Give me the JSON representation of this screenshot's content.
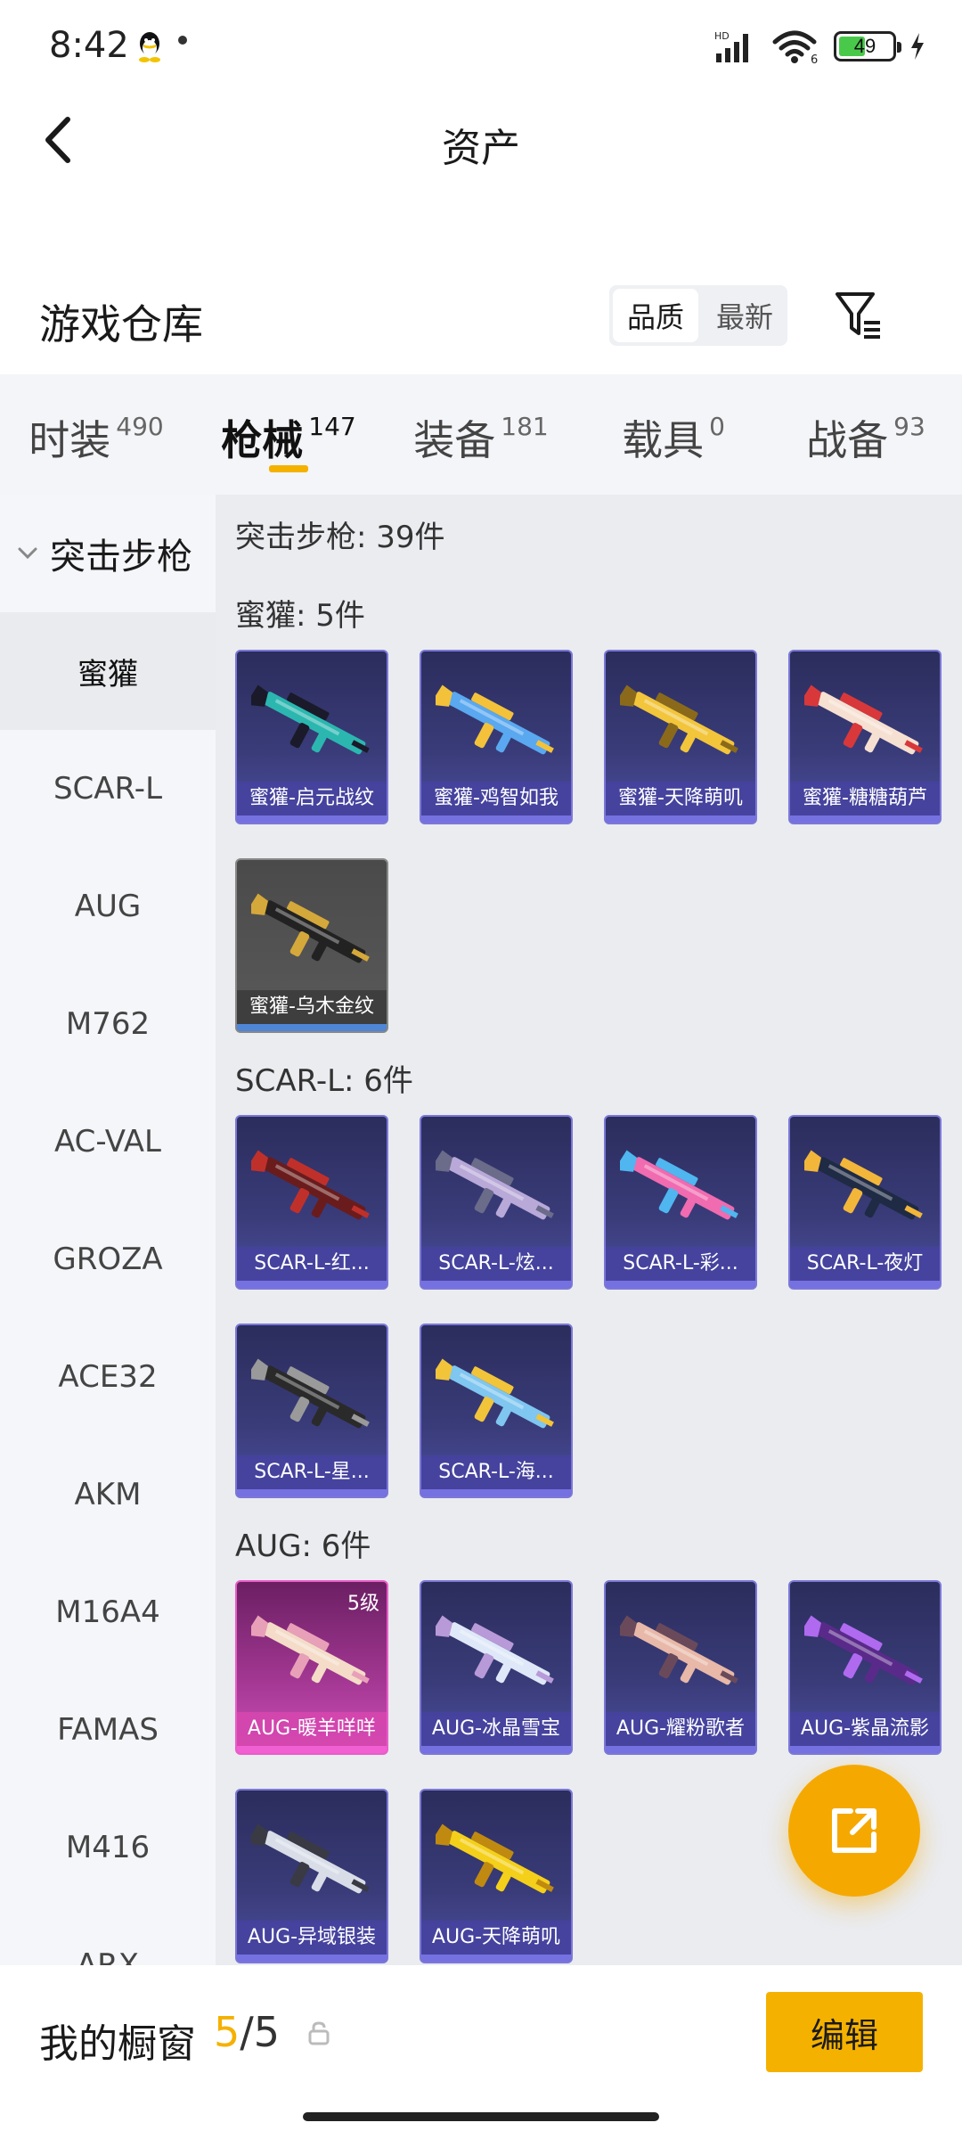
{
  "status_bar": {
    "time": "8:42",
    "battery": "49"
  },
  "header": {
    "title": "资产"
  },
  "warehouse": {
    "title": "游戏仓库",
    "sort_quality": "品质",
    "sort_newest": "最新"
  },
  "tabs": [
    {
      "label": "时装",
      "count": "490"
    },
    {
      "label": "枪械",
      "count": "147"
    },
    {
      "label": "装备",
      "count": "181"
    },
    {
      "label": "载具",
      "count": "0"
    },
    {
      "label": "战备",
      "count": "93"
    }
  ],
  "sidebar": {
    "category": "突击步枪",
    "items": [
      "蜜獾",
      "SCAR-L",
      "AUG",
      "M762",
      "AC-VAL",
      "GROZA",
      "ACE32",
      "AKM",
      "M16A4",
      "FAMAS",
      "M416",
      "ARX"
    ]
  },
  "content": {
    "category_summary": "突击步枪: 39件",
    "groups": [
      {
        "title": "蜜獾: 5件",
        "items": [
          {
            "label": "蜜獾-启元战纹"
          },
          {
            "label": "蜜獾-鸡智如我"
          },
          {
            "label": "蜜獾-天降萌叽"
          },
          {
            "label": "蜜獾-糖糖葫芦"
          },
          {
            "label": "蜜獾-乌木金纹"
          }
        ]
      },
      {
        "title": "SCAR-L: 6件",
        "items": [
          {
            "label": "SCAR-L-红..."
          },
          {
            "label": "SCAR-L-炫..."
          },
          {
            "label": "SCAR-L-彩..."
          },
          {
            "label": "SCAR-L-夜灯"
          },
          {
            "label": "SCAR-L-星..."
          },
          {
            "label": "SCAR-L-海..."
          }
        ]
      },
      {
        "title": "AUG: 6件",
        "items": [
          {
            "label": "AUG-暖羊咩咩",
            "level": "5级"
          },
          {
            "label": "AUG-冰晶雪宝"
          },
          {
            "label": "AUG-耀粉歌者"
          },
          {
            "label": "AUG-紫晶流影"
          },
          {
            "label": "AUG-异域银装"
          },
          {
            "label": "AUG-天降萌叽"
          }
        ]
      }
    ]
  },
  "bottom_bar": {
    "label": "我的橱窗",
    "current": "5",
    "separator": "/",
    "total": "5",
    "edit": "编辑"
  },
  "colors": {
    "accent": "#f5b100",
    "card_purple": "#3a3c7a",
    "card_pink": "#d04fb9"
  },
  "icons": {
    "back": "chevron-left-icon",
    "filter": "filter-icon",
    "share": "share-icon",
    "lock": "lock-icon"
  }
}
